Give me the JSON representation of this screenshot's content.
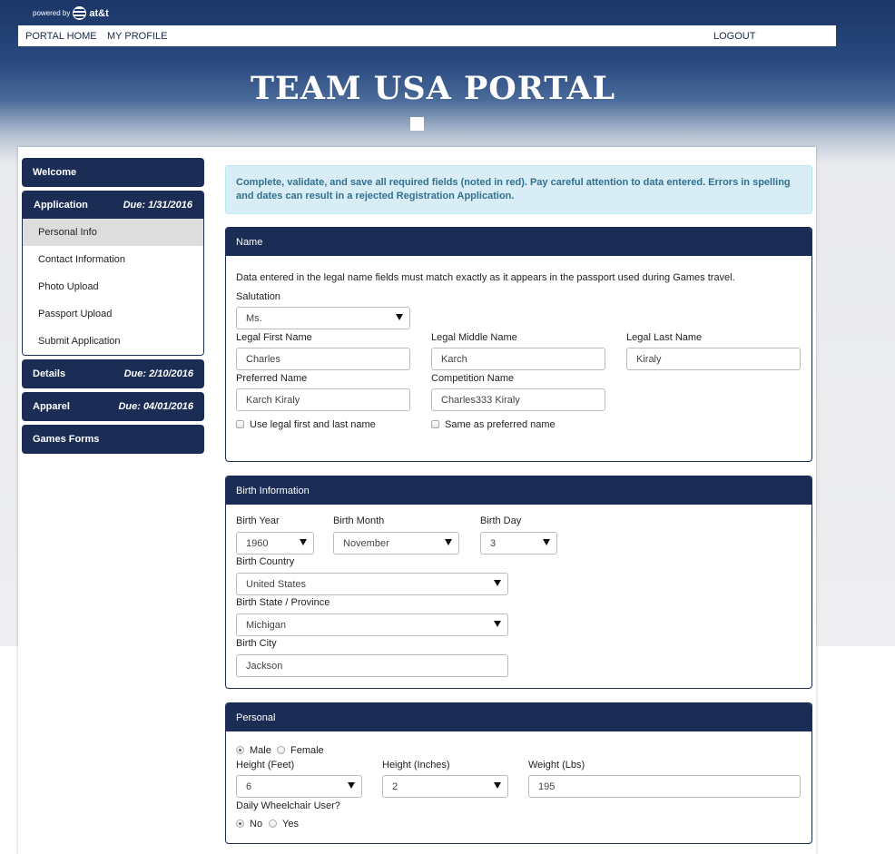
{
  "header": {
    "powered_by": "powered by",
    "brand": "at&t",
    "nav": {
      "home": "PORTAL HOME",
      "profile": "MY PROFILE",
      "logout": "LOGOUT"
    },
    "title": "TEAM USA PORTAL"
  },
  "sidebar": {
    "welcome": "Welcome",
    "application": {
      "label": "Application",
      "due": "Due: 1/31/2016"
    },
    "sub_items": [
      "Personal Info",
      "Contact Information",
      "Photo Upload",
      "Passport Upload",
      "Submit Application"
    ],
    "details": {
      "label": "Details",
      "due": "Due: 2/10/2016"
    },
    "apparel": {
      "label": "Apparel",
      "due": "Due: 04/01/2016"
    },
    "games_forms": "Games Forms"
  },
  "alert": "Complete, validate, and save all required fields (noted in red). Pay careful attention to data entered. Errors in spelling and dates can result in a rejected Registration Application.",
  "name_panel": {
    "title": "Name",
    "note": "Data entered in the legal name fields must match exactly as it appears in the passport used during Games travel.",
    "salutation_label": "Salutation",
    "salutation_value": "Ms.",
    "first_label": "Legal First Name",
    "first_value": "Charles",
    "middle_label": "Legal Middle Name",
    "middle_value": "Karch",
    "last_label": "Legal Last Name",
    "last_value": "Kiraly",
    "preferred_label": "Preferred Name",
    "preferred_value": "Karch Kiraly",
    "competition_label": "Competition Name",
    "competition_value": "Charles333 Kiraly",
    "use_legal_label": "Use legal first and last name",
    "same_preferred_label": "Same as preferred name"
  },
  "birth_panel": {
    "title": "Birth Information",
    "year_label": "Birth Year",
    "year_value": "1960",
    "month_label": "Birth Month",
    "month_value": "November",
    "day_label": "Birth Day",
    "day_value": "3",
    "country_label": "Birth Country",
    "country_value": "United States",
    "state_label": "Birth State / Province",
    "state_value": "Michigan",
    "city_label": "Birth City",
    "city_value": "Jackson"
  },
  "personal_panel": {
    "title": "Personal",
    "gender_options": [
      "Male",
      "Female"
    ],
    "gender_selected": "Male",
    "height_feet_label": "Height (Feet)",
    "height_feet_value": "6",
    "height_inches_label": "Height (Inches)",
    "height_inches_value": "2",
    "weight_label": "Weight (Lbs)",
    "weight_value": "195",
    "wheelchair_label": "Daily Wheelchair User?",
    "wheelchair_options": [
      "No",
      "Yes"
    ],
    "wheelchair_selected": "No"
  }
}
